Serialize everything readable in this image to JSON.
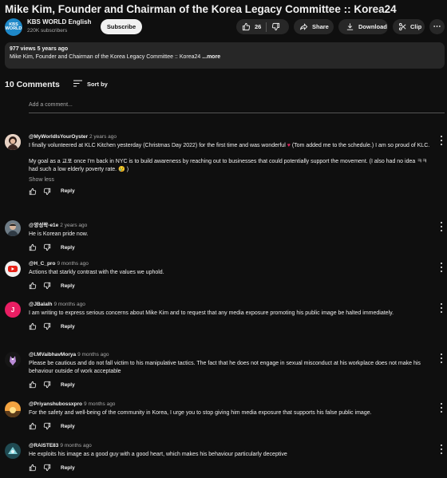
{
  "video": {
    "title": "Mike Kim, Founder and Chairman of the Korea Legacy Committee :: Korea24"
  },
  "channel": {
    "name": "KBS WORLD English",
    "subscribers": "220K subscribers",
    "logo_text": "KBS WORLD",
    "subscribe_label": "Subscribe"
  },
  "actions": {
    "like_count": "26",
    "share_label": "Share",
    "download_label": "Download",
    "clip_label": "Clip",
    "icons": [
      "thumb-up-icon",
      "thumb-down-icon",
      "share-icon",
      "download-icon",
      "scissors-icon",
      "more-horizontal-icon"
    ]
  },
  "description": {
    "meta": "977 views  5 years ago",
    "text": "Mike Kim, Founder and Chairman of the Korea Legacy Committee :: Korea24",
    "more_label": " ...more"
  },
  "comments_header": {
    "count_label": "10 Comments",
    "sort_label": "Sort by"
  },
  "add_comment": {
    "placeholder": "Add a comment..."
  },
  "reply_label": "Reply",
  "show_less_label": "Show less",
  "colors": {
    "background": "#0f0f0f",
    "surface": "#272727",
    "text": "#f1f1f1",
    "muted": "#aaaaaa",
    "accent_heart": "#e0245e"
  },
  "comments": [
    {
      "author": "@MyWorldIsYourOyster",
      "time": "2 years ago",
      "para1_a": "I finally volunteered at KLC Kitchen yesterday (Christmas Day 2022) for the first time and was wonderful",
      "heart": "♥",
      "para1_b": " (Tom added me to the schedule.) I am so proud of KLC.",
      "para2": "My goal as a 교포 once I'm back in NYC is to build awareness by reaching out to businesses that could potentially support the movement. (I also had no idea ㅋㅋ had such a low elderly poverty rate. 😢 )"
    },
    {
      "author": "@양성락-e1e",
      "time": "2 years ago",
      "text": "He is Korean pride now."
    },
    {
      "author": "@H_C_pro",
      "time": "9 months ago",
      "text": "Actions that starkly contrast with the values we uphold."
    },
    {
      "author": "@JBalalh",
      "time": "9 months ago",
      "avatar_letter": "J",
      "text": "I am writing to express serious concerns about Mike Kim and to request that any media exposure promoting his public image be halted immediately."
    },
    {
      "author": "@I.MVaibhavMorya",
      "time": "9 months ago",
      "text": "Please be cautious and do not fall victim to his manipulative tactics. The fact that he does not engage in sexual misconduct at his workplace does not make his behaviour outside of work acceptable"
    },
    {
      "author": "@Priyanshubossxpro",
      "time": "9 months ago",
      "text": "For the safety and well-being of the community in Korea, I urge you to stop giving him media exposure that supports his false public image."
    },
    {
      "author": "@RAISTE83",
      "time": "9 months ago",
      "text": "He exploits his image as a good guy with a good heart, which makes his behaviour particularly deceptive"
    }
  ]
}
